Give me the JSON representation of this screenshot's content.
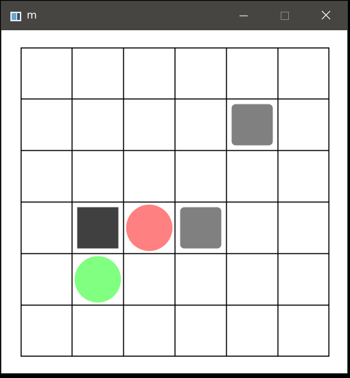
{
  "window": {
    "title": "m",
    "app_icon": "window-app-icon",
    "controls": {
      "minimize_icon": "minimize-icon",
      "maximize_icon": "maximize-icon",
      "close_icon": "close-icon"
    },
    "titlebar_color": "#474542"
  },
  "board": {
    "columns": 6,
    "rows": 6,
    "grid_color": "#000000",
    "pieces": [
      {
        "type": "wall-block",
        "shape": "square",
        "color": "#404040",
        "col": 1,
        "row": 3
      },
      {
        "type": "movable-box",
        "shape": "rounded-square",
        "color": "#808080",
        "col": 4,
        "row": 1
      },
      {
        "type": "movable-box",
        "shape": "rounded-square",
        "color": "#808080",
        "col": 3,
        "row": 3
      },
      {
        "type": "player",
        "shape": "circle",
        "color": "#ff8080",
        "col": 2,
        "row": 3
      },
      {
        "type": "goal",
        "shape": "circle",
        "color": "#80ff80",
        "col": 1,
        "row": 4
      }
    ]
  }
}
